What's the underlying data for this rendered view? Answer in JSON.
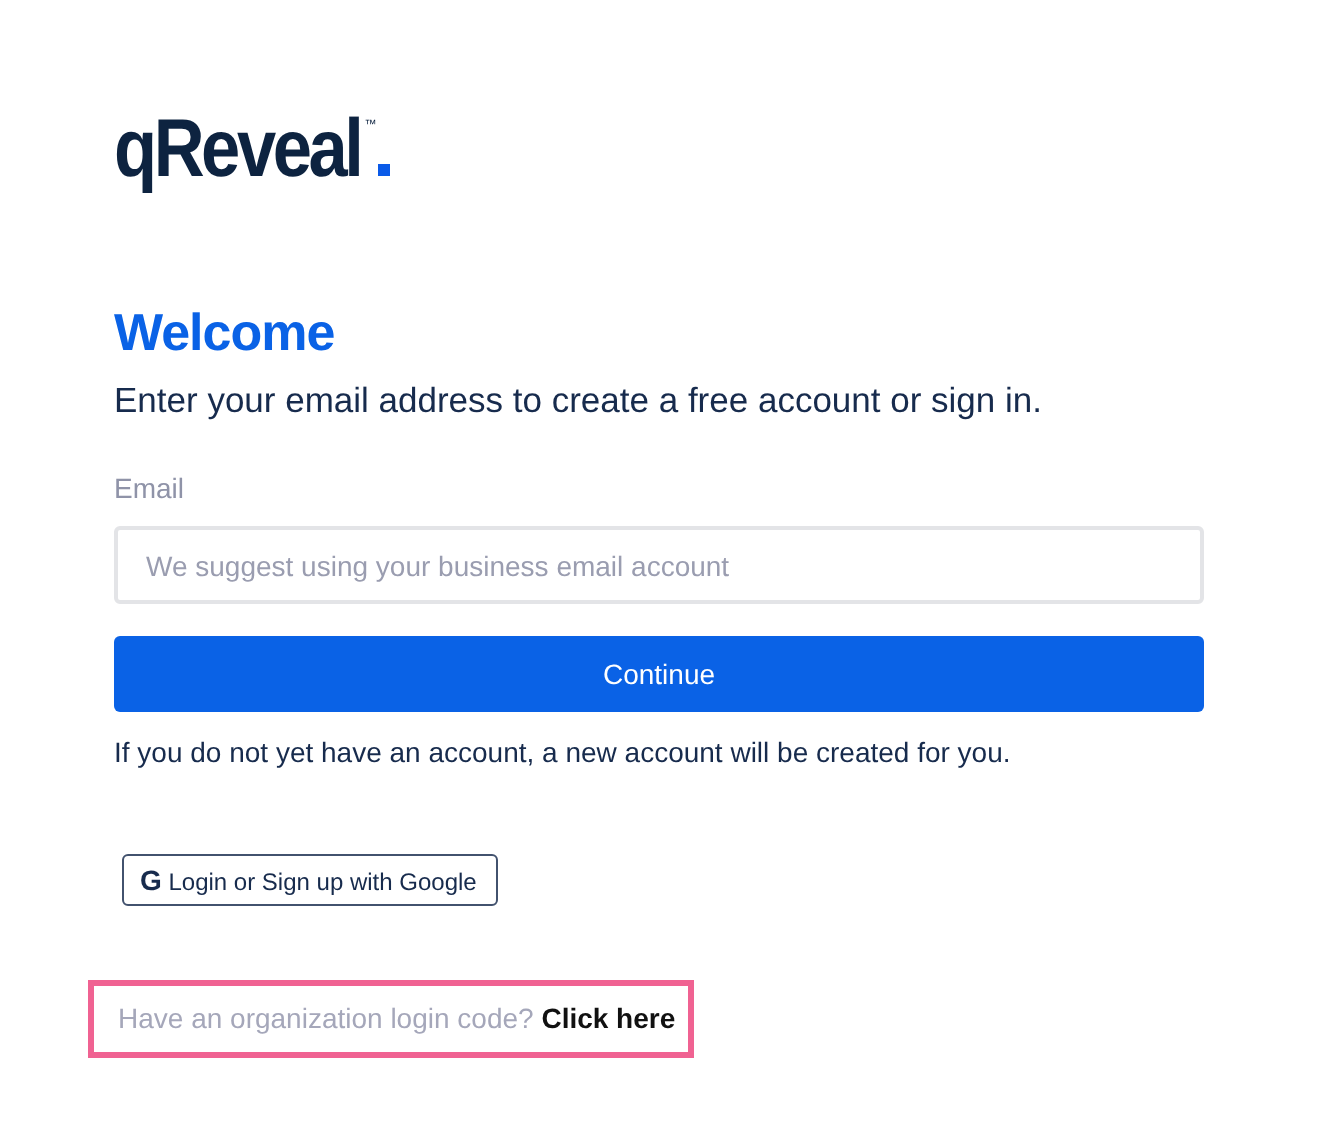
{
  "logo": {
    "text": "qReveal",
    "mark": "™"
  },
  "heading": "Welcome",
  "subtitle": "Enter your email address to create a free account or sign in.",
  "email": {
    "label": "Email",
    "placeholder": "We suggest using your business email account"
  },
  "continue_button": "Continue",
  "note": "If you do not yet have an account, a new account will be created for you.",
  "google_button": {
    "icon": "G",
    "label": "Login or Sign up with Google"
  },
  "org_code": {
    "prompt": "Have an organization login code?",
    "link": "Click here",
    "highlighted": true
  }
}
